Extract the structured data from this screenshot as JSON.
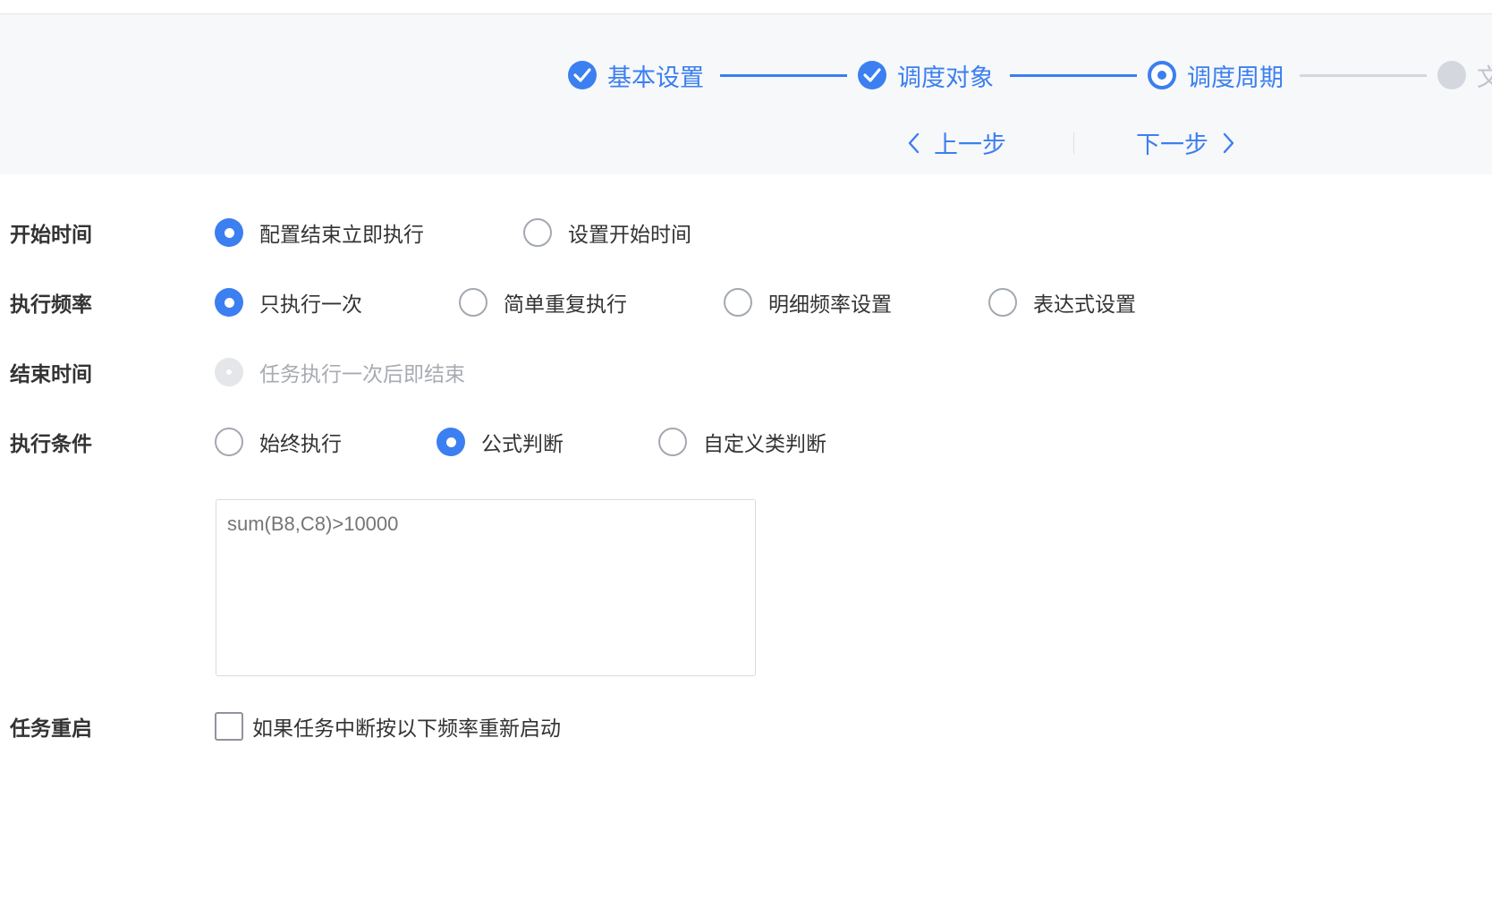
{
  "steps": [
    {
      "label": "基本设置",
      "state": "done"
    },
    {
      "label": "调度对象",
      "state": "done"
    },
    {
      "label": "调度周期",
      "state": "current"
    },
    {
      "label": "文",
      "state": "todo"
    }
  ],
  "nav": {
    "prev_label": "上一步",
    "next_label": "下一步"
  },
  "form": {
    "start_time": {
      "label": "开始时间",
      "options": [
        "配置结束立即执行",
        "设置开始时间"
      ],
      "selected": 0
    },
    "frequency": {
      "label": "执行频率",
      "options": [
        "只执行一次",
        "简单重复执行",
        "明细频率设置",
        "表达式设置"
      ],
      "selected": 0
    },
    "end_time": {
      "label": "结束时间",
      "options": [
        "任务执行一次后即结束"
      ],
      "selected": 0,
      "disabled": true
    },
    "condition": {
      "label": "执行条件",
      "options": [
        "始终执行",
        "公式判断",
        "自定义类判断"
      ],
      "selected": 1,
      "formula_placeholder": "sum(B8,C8)>10000"
    },
    "restart": {
      "label": "任务重启",
      "checkbox_label": "如果任务中断按以下频率重新启动",
      "checked": false
    }
  },
  "colors": {
    "accent": "#3b7ff0",
    "inactive": "#d4d7dd",
    "header_bg": "#f7f8fa"
  }
}
